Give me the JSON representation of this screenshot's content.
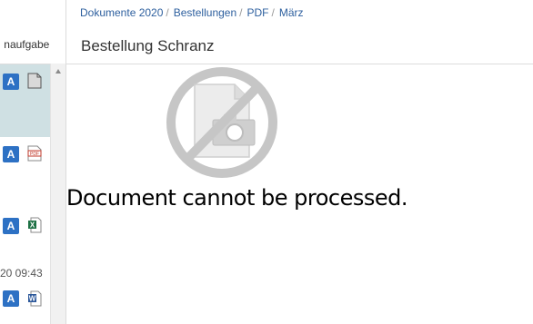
{
  "tasks_panel": {
    "header_label": "naufgaben",
    "rows": [
      {
        "badge": "A",
        "file_icon": "generic-file-icon"
      },
      {
        "badge": "A",
        "file_icon": "pdf-file-icon",
        "file_icon_text": "PDF"
      },
      {
        "badge": "A",
        "file_icon": "excel-file-icon",
        "file_icon_text": "X"
      },
      {
        "badge": "A",
        "file_icon": "word-file-icon",
        "file_icon_text": "W"
      }
    ],
    "timestamp": "20 09:43"
  },
  "breadcrumb": {
    "items": [
      "Dokumente 2020",
      "Bestellungen",
      "PDF",
      "März"
    ],
    "separator": "/"
  },
  "document": {
    "title": "Bestellung Schranz",
    "message": "Document cannot be processed."
  },
  "colors": {
    "accent": "#2d71c4",
    "link": "#2d5f9e",
    "selected_row": "#cfe0e3"
  }
}
